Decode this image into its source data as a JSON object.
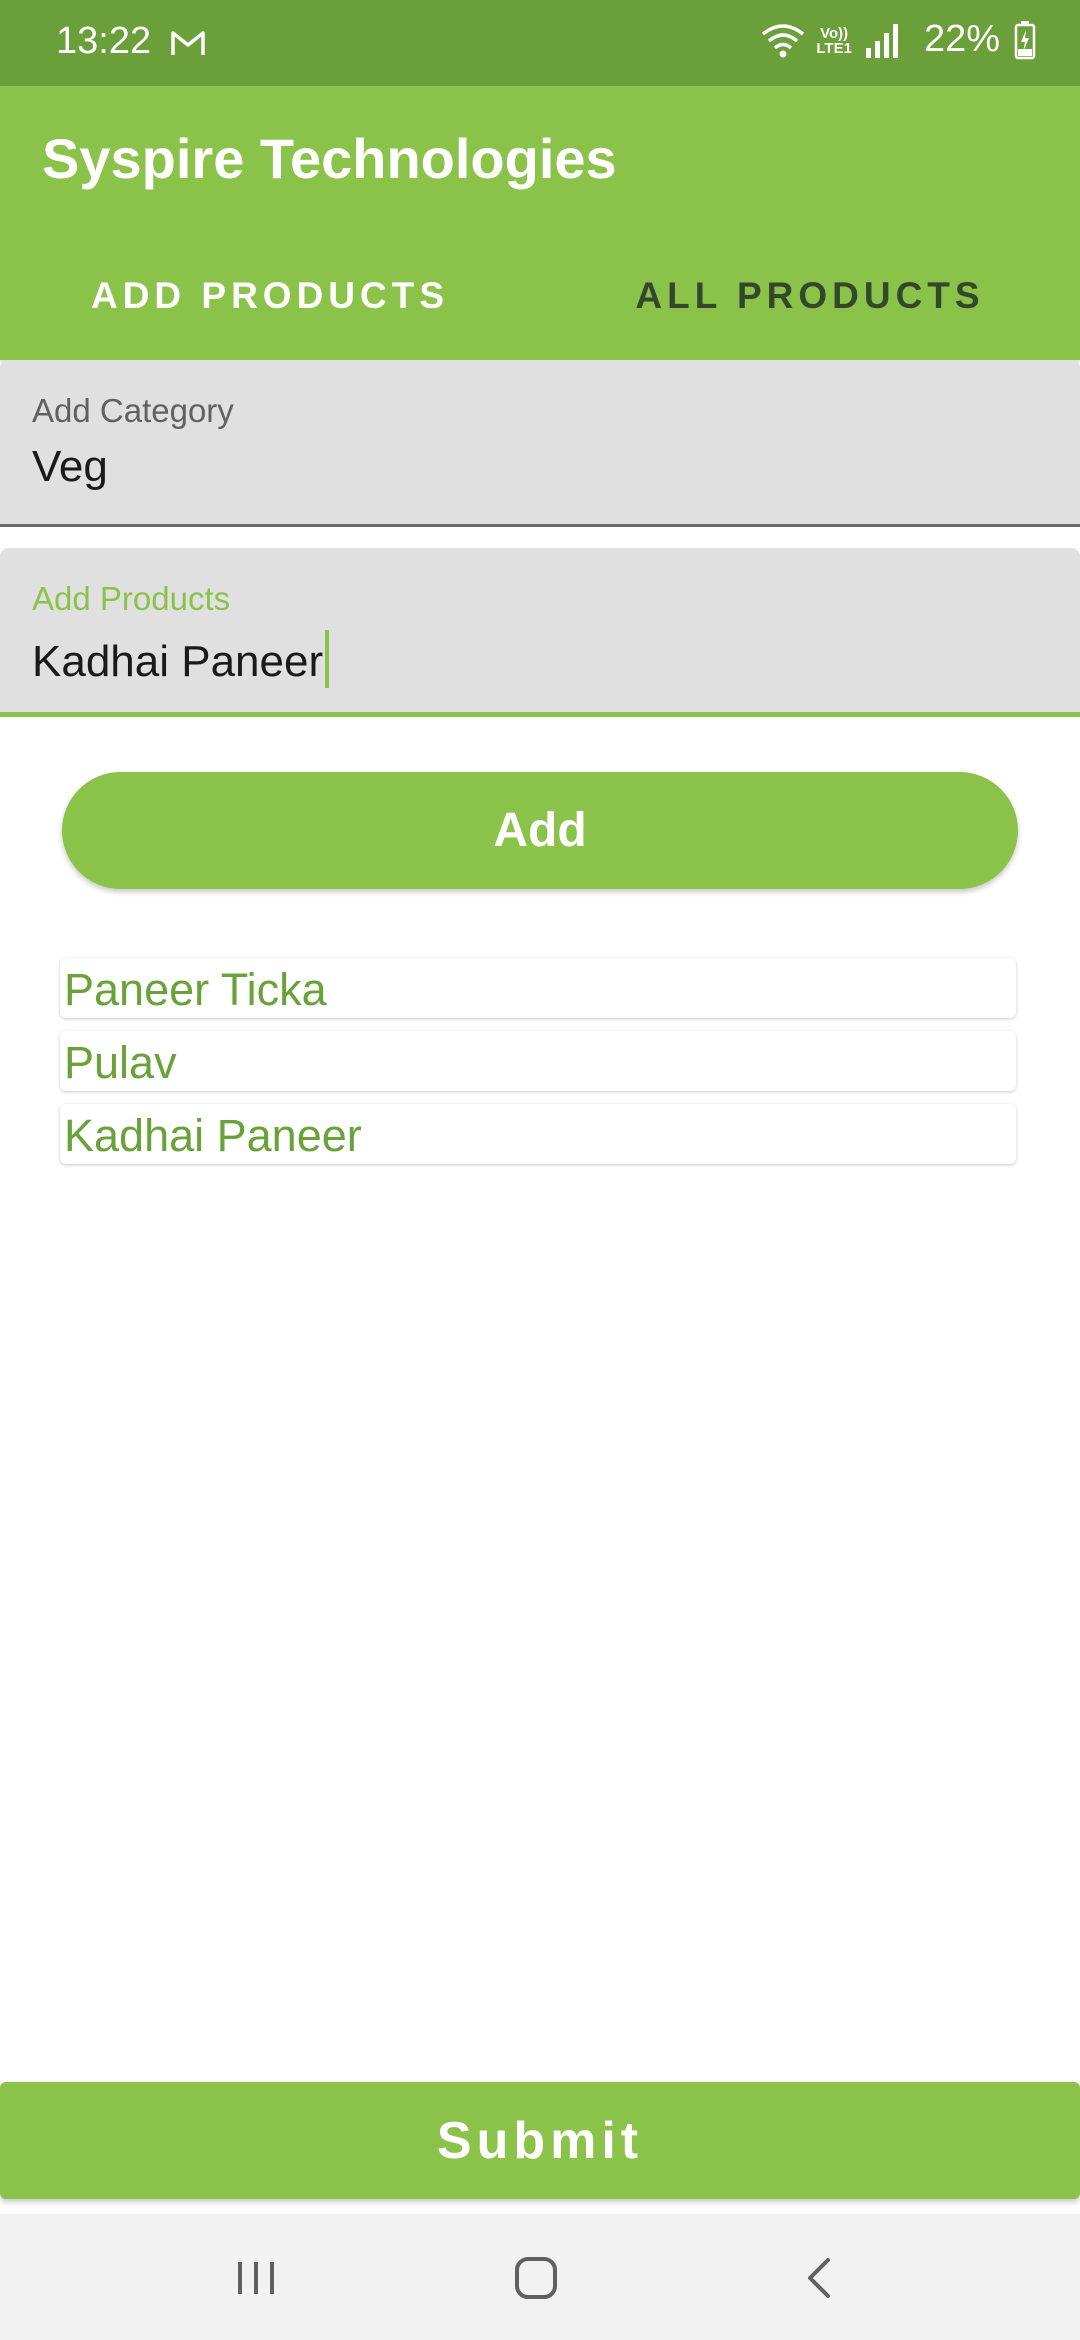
{
  "status_bar": {
    "time": "13:22",
    "network_label_top": "Vo))",
    "network_label_bottom": "LTE1",
    "battery": "22%"
  },
  "app_bar": {
    "title": "Syspire Technologies"
  },
  "tabs": [
    {
      "label": "ADD PRODUCTS",
      "selected": true
    },
    {
      "label": "ALL PRODUCTS",
      "selected": false
    }
  ],
  "form": {
    "category": {
      "label": "Add Category",
      "value": "Veg"
    },
    "product": {
      "label": "Add Products",
      "value": "Kadhai Paneer"
    }
  },
  "add_button": {
    "label": "Add"
  },
  "products": [
    "Paneer Ticka",
    "Pulav",
    "Kadhai Paneer"
  ],
  "submit_button": {
    "label": "Submit"
  },
  "colors": {
    "primary": "#8bc34a",
    "status_bar": "#6a9f3a",
    "list_text": "#6aa23a"
  }
}
